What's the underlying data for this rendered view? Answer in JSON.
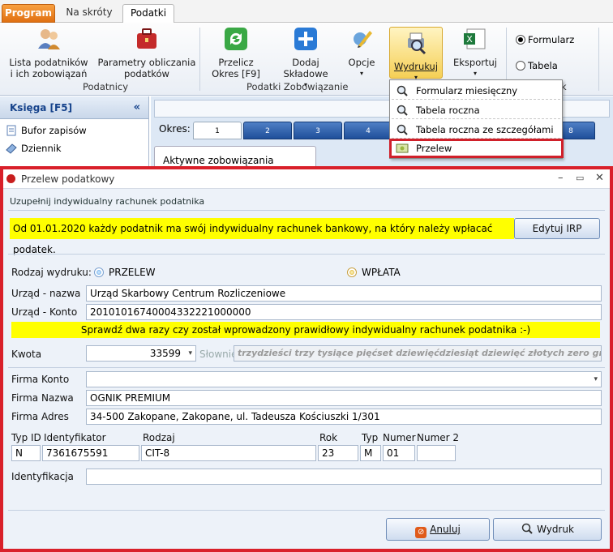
{
  "tabs": {
    "program": "Program",
    "skroty": "Na skróty",
    "podatki": "Podatki"
  },
  "ribbon": {
    "lista": "Lista podatników\ni ich zobowiązań",
    "parametry": "Parametry obliczania\npodatków",
    "group_podatnicy": "Podatnicy",
    "przelicz": "Przelicz\nOkres [F9]",
    "dodaj": "Dodaj\nSkładowe",
    "opcje": "Opcje",
    "group_zobowiazanie": "Podatki Zobowiązanie",
    "wydrukuj": "Wydrukuj",
    "eksportuj": "Eksportuj",
    "radio_formularz": "Formularz",
    "radio_tabela": "Tabela",
    "group_k": "k"
  },
  "menu": {
    "items": [
      "Formularz miesięczny",
      "Tabela roczna",
      "Tabela roczna ze szczegółami",
      "Przelew"
    ]
  },
  "leftpanel": {
    "header": "Księga [F5]",
    "items": [
      "Bufor zapisów",
      "Dziennik"
    ]
  },
  "main": {
    "okres_label": "Okres:",
    "okres_tabs": [
      "1",
      "2",
      "3",
      "4",
      "8"
    ],
    "aktywne": "Aktywne zobowiązania"
  },
  "dialog": {
    "title": "Przelew podatkowy",
    "subtitle": "Uzupełnij indywidualny rachunek podatnika",
    "info": "Od 01.01.2020 każdy podatnik ma swój indywidualny rachunek bankowy, na który należy wpłacać podatek.",
    "edytuj_irp": "Edytuj IRP",
    "rodzaj_label": "Rodzaj wydruku:",
    "opt_przelew": "PRZELEW",
    "opt_wplata": "WPŁATA",
    "urzad_nazwa_label": "Urząd - nazwa",
    "urzad_nazwa": "Urząd Skarbowy Centrum Rozliczeniowe",
    "urzad_konto_label": "Urząd - Konto",
    "urzad_konto": "20101016740004332221000000",
    "warning": "Sprawdź dwa razy czy został wprowadzony prawidłowy indywidualny rachunek podatnika :-)",
    "kwota_label": "Kwota",
    "kwota": "33599",
    "slownie_label": "Słownie",
    "slownie": "trzydzieści trzy tysiące pięćset dziewięćdziesiąt dziewięć złotych zero groszy",
    "firma_konto_label": "Firma Konto",
    "firma_konto": "",
    "firma_nazwa_label": "Firma Nazwa",
    "firma_nazwa": "OGNIK PREMIUM",
    "firma_adres_label": "Firma Adres",
    "firma_adres": "34-500 Zakopane, Zakopane, ul. Tadeusza Kościuszki 1/301",
    "typ_id_label": "Typ ID",
    "identyfikator_label": "Identyfikator",
    "rodzaj2_label": "Rodzaj",
    "rok_label": "Rok",
    "typ_label": "Typ",
    "numer_label": "Numer",
    "numer2_label": "Numer 2",
    "typ_id": "N",
    "identyfikator": "7361675591",
    "rodzaj": "CIT-8",
    "rok": "23",
    "typ": "M",
    "numer": "01",
    "numer2": "",
    "identyfikacja_label": "Identyfikacja",
    "identyfikacja": "",
    "anuluj": "Anuluj",
    "wydruk": "Wydruk"
  },
  "colors": {
    "accent_red": "#d9202a",
    "highlight_yellow": "#ffff00",
    "tab_blue": "#1f4f9a",
    "program_orange": "#f08a24"
  }
}
